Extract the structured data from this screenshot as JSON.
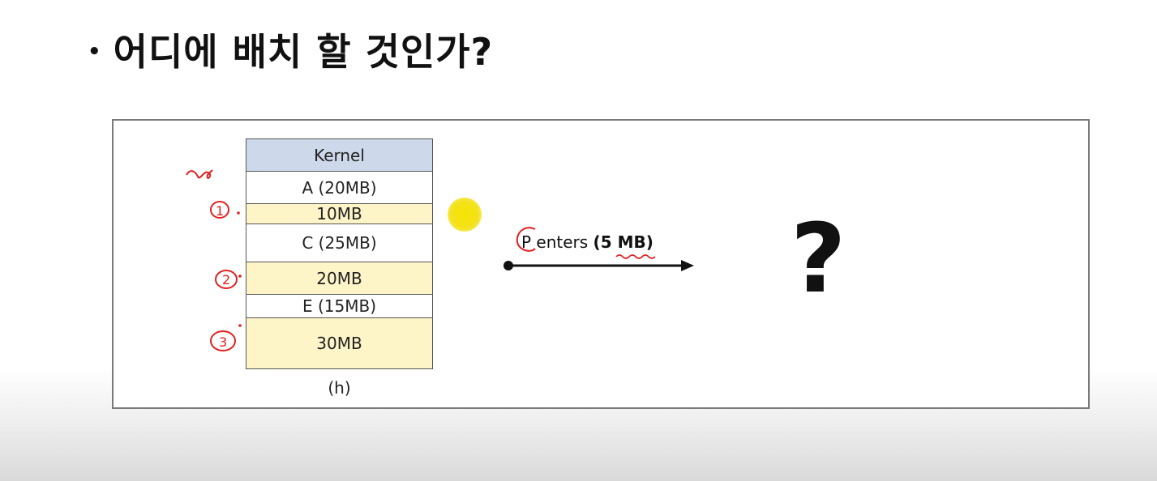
{
  "title": {
    "bullet": "•",
    "text": "어디에 배치 할 것인가?"
  },
  "memory": {
    "blocks": [
      {
        "label": "Kernel",
        "kind": "kernel"
      },
      {
        "label": "A (20MB)",
        "kind": "used"
      },
      {
        "label": "10MB",
        "kind": "free"
      },
      {
        "label": "C (25MB)",
        "kind": "used"
      },
      {
        "label": "20MB",
        "kind": "free"
      },
      {
        "label": "E (15MB)",
        "kind": "used"
      },
      {
        "label": "30MB",
        "kind": "free"
      }
    ],
    "caption": "(h)"
  },
  "arrow": {
    "label_prefix": "P enters ",
    "label_bold": "(5 MB)"
  },
  "result": {
    "symbol": "?"
  },
  "annotations": {
    "numbers": [
      "1",
      "2",
      "3"
    ]
  },
  "colors": {
    "kernel": "#cdd8ea",
    "free": "#fdf4c8",
    "ink": "#e02020",
    "pointer": "#f5e400"
  }
}
